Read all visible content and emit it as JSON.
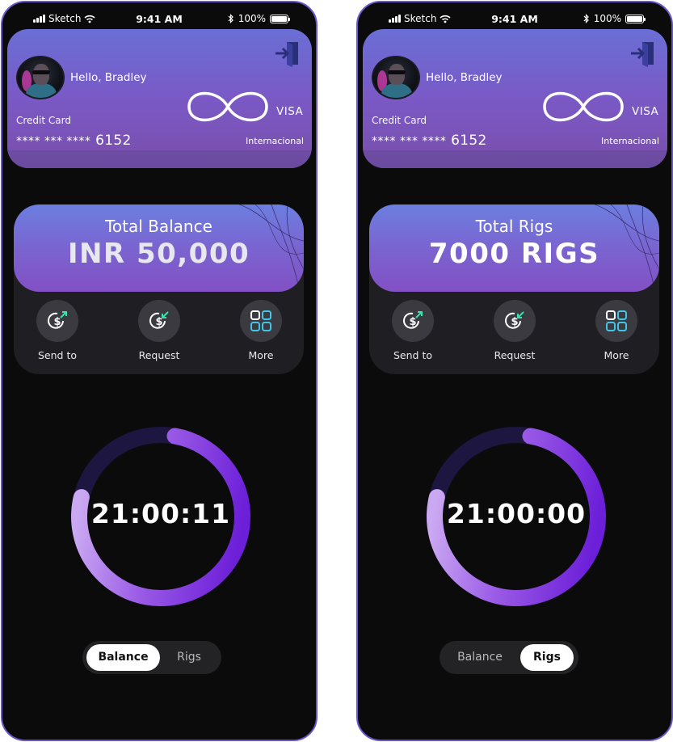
{
  "colors": {
    "accent": "#7b3fe0",
    "card_gradient_top": "#6a6fd5",
    "card_gradient_bottom": "#7a4eaa",
    "background": "#0b0b0b",
    "icon_up_green": "#3ee0b0",
    "more_icon_teal": "#3fc7e8"
  },
  "screens": [
    {
      "status": {
        "carrier": "Sketch",
        "time": "9:41 AM",
        "battery": "100%"
      },
      "card": {
        "greeting": "Hello, Bradley",
        "type": "Credit Card",
        "number_mask": "**** *** ****",
        "number_last4": "6152",
        "brand": "VISA",
        "scope": "Internacional"
      },
      "balance": {
        "label": "Total Balance",
        "value": "INR 50,000"
      },
      "actions": [
        {
          "label": "Send to",
          "icon": "send-money-icon"
        },
        {
          "label": "Request",
          "icon": "request-money-icon"
        },
        {
          "label": "More",
          "icon": "grid-icon"
        }
      ],
      "timer": {
        "value": "21:00:11",
        "progress": 0.76
      },
      "toggle": {
        "options": [
          "Balance",
          "Rigs"
        ],
        "active": "Balance"
      }
    },
    {
      "status": {
        "carrier": "Sketch",
        "time": "9:41 AM",
        "battery": "100%"
      },
      "card": {
        "greeting": "Hello, Bradley",
        "type": "Credit Card",
        "number_mask": "**** *** ****",
        "number_last4": "6152",
        "brand": "VISA",
        "scope": "Internacional"
      },
      "balance": {
        "label": "Total Rigs",
        "value": "7000 RIGS"
      },
      "actions": [
        {
          "label": "Send to",
          "icon": "send-money-icon"
        },
        {
          "label": "Request",
          "icon": "request-money-icon"
        },
        {
          "label": "More",
          "icon": "grid-icon"
        }
      ],
      "timer": {
        "value": "21:00:00",
        "progress": 0.76
      },
      "toggle": {
        "options": [
          "Balance",
          "Rigs"
        ],
        "active": "Rigs"
      }
    }
  ]
}
